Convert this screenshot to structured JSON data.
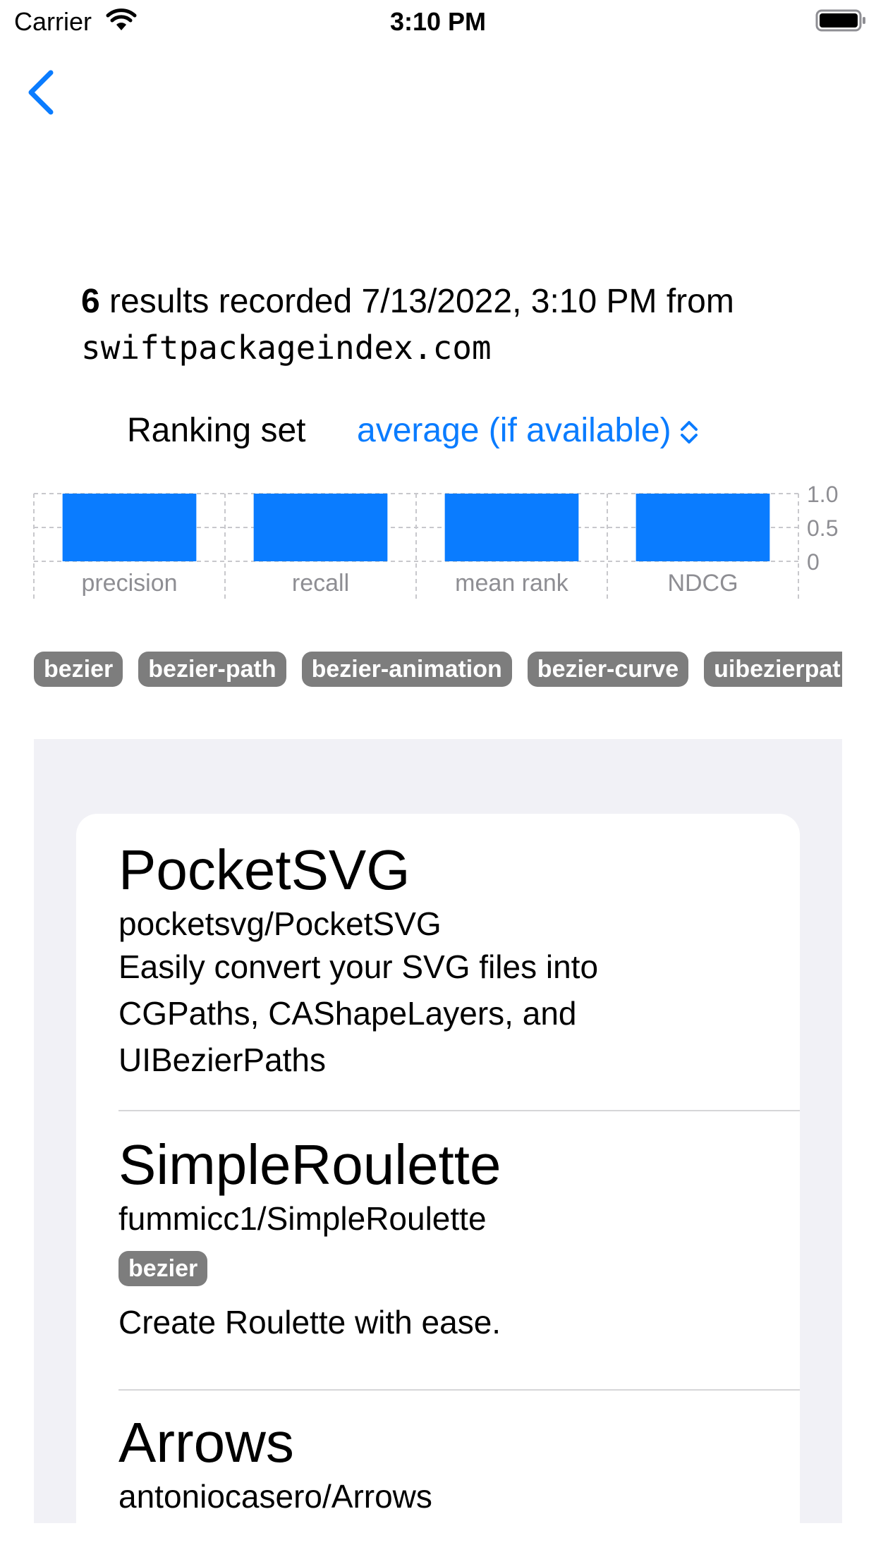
{
  "status_bar": {
    "carrier": "Carrier",
    "time": "3:10 PM"
  },
  "summary": {
    "count": "6",
    "recorded_text": " results recorded  7/13/2022, 3:10 PM from",
    "source": "swiftpackageindex.com"
  },
  "ranking": {
    "label": "Ranking set",
    "value": "average (if available)"
  },
  "chart_data": {
    "type": "bar",
    "categories": [
      "precision",
      "recall",
      "mean rank",
      "NDCG"
    ],
    "values": [
      1.0,
      1.0,
      1.0,
      1.0
    ],
    "yticks": [
      "1.0",
      "0.5",
      "0"
    ],
    "ylim": [
      0,
      1.0
    ],
    "grid": true,
    "bar_color": "#0a7cff"
  },
  "tags": [
    "bezier",
    "bezier-path",
    "bezier-animation",
    "bezier-curve",
    "uibezierpath"
  ],
  "results": [
    {
      "name": "PocketSVG",
      "repo": "pocketsvg/PocketSVG",
      "tags": [],
      "description_lines": [
        "Easily convert your SVG files into",
        "CGPaths, CAShapeLayers, and",
        "UIBezierPaths"
      ]
    },
    {
      "name": "SimpleRoulette",
      "repo": "fummicc1/SimpleRoulette",
      "tags": [
        "bezier"
      ],
      "description_lines": [
        "Create Roulette with ease."
      ]
    },
    {
      "name": "Arrows",
      "repo": "antoniocasero/Arrows",
      "tags": [],
      "description_lines": []
    }
  ],
  "colors": {
    "accent": "#0a7cff",
    "tag_bg": "#7d7d7d",
    "panel_bg": "#f1f1f6"
  },
  "icons": {
    "back": "chevron-left-icon",
    "select": "chevron-up-down-icon",
    "wifi": "wifi-icon",
    "battery": "battery-icon"
  }
}
